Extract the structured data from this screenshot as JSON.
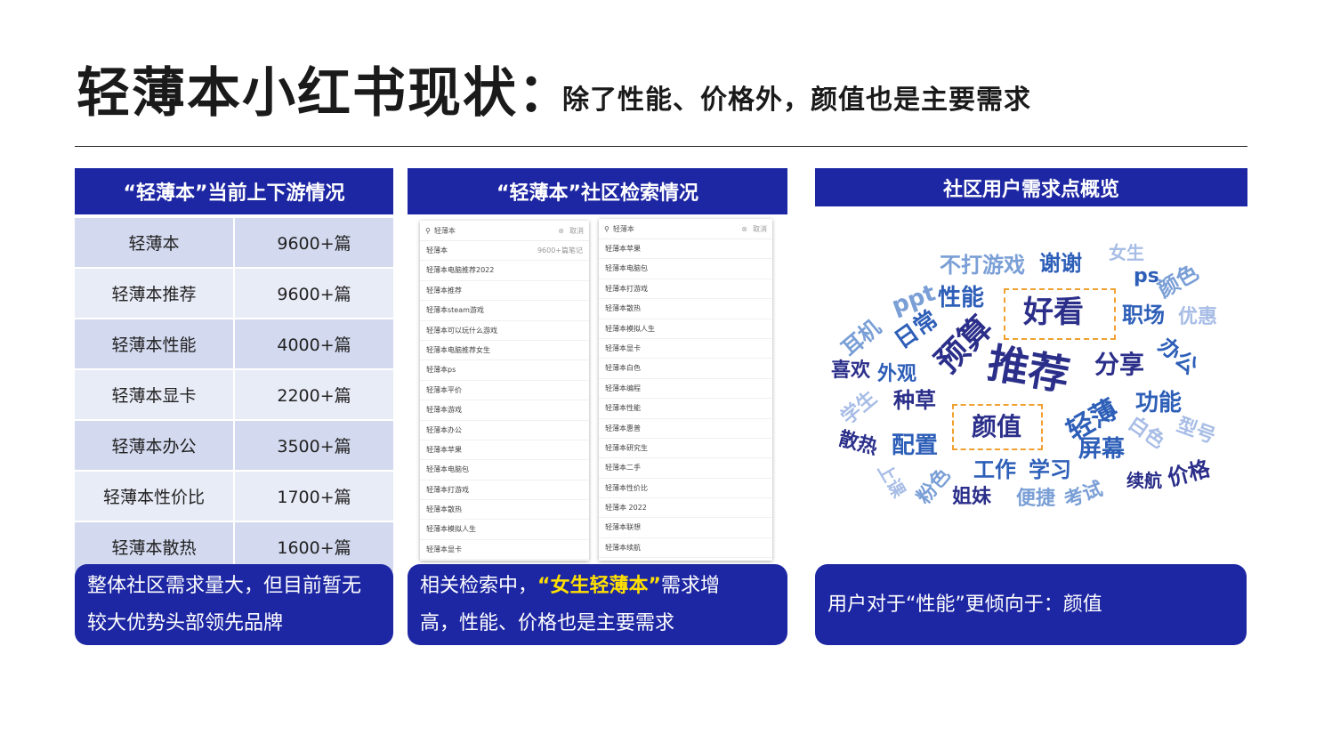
{
  "header": {
    "title": "轻薄本小红书现状：",
    "subtitle": "除了性能、价格外，颜值也是主要需求"
  },
  "panel1": {
    "title": "“轻薄本”当前上下游情况",
    "rows": [
      {
        "keyword": "轻薄本",
        "count": "9600+篇"
      },
      {
        "keyword": "轻薄本推荐",
        "count": "9600+篇"
      },
      {
        "keyword": "轻薄本性能",
        "count": "4000+篇"
      },
      {
        "keyword": "轻薄本显卡",
        "count": "2200+篇"
      },
      {
        "keyword": "轻薄本办公",
        "count": "3500+篇"
      },
      {
        "keyword": "轻薄本性价比",
        "count": "1700+篇"
      },
      {
        "keyword": "轻薄本散热",
        "count": "1600+篇"
      }
    ],
    "summary_line1": "整体社区需求量大，但目前暂无",
    "summary_line2": "较大优势头部领先品牌"
  },
  "panel2": {
    "title": "“轻薄本”社区检索情况",
    "search_left": {
      "query": "轻薄本",
      "cancel": "取消",
      "items": [
        {
          "text": "轻薄本",
          "count": "9600+篇笔记"
        },
        {
          "text": "轻薄本电脑推荐2022",
          "count": ""
        },
        {
          "text": "轻薄本推荐",
          "count": ""
        },
        {
          "text": "轻薄本steam游戏",
          "count": ""
        },
        {
          "text": "轻薄本可以玩什么游戏",
          "count": ""
        },
        {
          "text": "轻薄本电脑推荐女生",
          "count": ""
        },
        {
          "text": "轻薄本ps",
          "count": ""
        },
        {
          "text": "轻薄本平价",
          "count": ""
        },
        {
          "text": "轻薄本游戏",
          "count": ""
        },
        {
          "text": "轻薄本办公",
          "count": ""
        },
        {
          "text": "轻薄本苹果",
          "count": ""
        },
        {
          "text": "轻薄本电脑包",
          "count": ""
        },
        {
          "text": "轻薄本打游戏",
          "count": ""
        },
        {
          "text": "轻薄本散热",
          "count": ""
        },
        {
          "text": "轻薄本模拟人生",
          "count": ""
        },
        {
          "text": "轻薄本显卡",
          "count": ""
        }
      ]
    },
    "search_right": {
      "query": "轻薄本",
      "cancel": "取消",
      "items": [
        {
          "text": "轻薄本苹果",
          "count": ""
        },
        {
          "text": "轻薄本电脑包",
          "count": ""
        },
        {
          "text": "轻薄本打游戏",
          "count": ""
        },
        {
          "text": "轻薄本散热",
          "count": ""
        },
        {
          "text": "轻薄本模拟人生",
          "count": ""
        },
        {
          "text": "轻薄本显卡",
          "count": ""
        },
        {
          "text": "轻薄本白色",
          "count": ""
        },
        {
          "text": "轻薄本编程",
          "count": ""
        },
        {
          "text": "轻薄本性能",
          "count": ""
        },
        {
          "text": "轻薄本惠普",
          "count": ""
        },
        {
          "text": "轻薄本研究生",
          "count": ""
        },
        {
          "text": "轻薄本二手",
          "count": ""
        },
        {
          "text": "轻薄本性价比",
          "count": ""
        },
        {
          "text": "轻薄本 2022",
          "count": ""
        },
        {
          "text": "轻薄本联想",
          "count": ""
        },
        {
          "text": "轻薄本续航",
          "count": ""
        }
      ]
    },
    "summary_pre": "相关检索中，",
    "summary_highlight": "“女生轻薄本”",
    "summary_post": "需求增",
    "summary_line2": "高，性能、价格也是主要需求"
  },
  "panel3": {
    "title": "社区用户需求点概览",
    "summary": "用户对于“性能”更倾向于：颜值",
    "colors": {
      "dark": "#2b2f8a",
      "mid": "#2e5fb8",
      "light": "#7a9fd6",
      "pale": "#a8bde6",
      "box": "#f0a030"
    },
    "words": [
      {
        "text": "不打游戏",
        "tone": "light"
      },
      {
        "text": "谢谢",
        "tone": "mid"
      },
      {
        "text": "女生",
        "tone": "pale"
      },
      {
        "text": "ps",
        "tone": "mid"
      },
      {
        "text": "颜色",
        "tone": "light"
      },
      {
        "text": "ppt",
        "tone": "light"
      },
      {
        "text": "性能",
        "tone": "mid"
      },
      {
        "text": "好看",
        "tone": "dark"
      },
      {
        "text": "职场",
        "tone": "mid"
      },
      {
        "text": "优惠",
        "tone": "pale"
      },
      {
        "text": "耳机",
        "tone": "light"
      },
      {
        "text": "日常",
        "tone": "mid"
      },
      {
        "text": "预算",
        "tone": "dark"
      },
      {
        "text": "推荐",
        "tone": "dark"
      },
      {
        "text": "分享",
        "tone": "dark"
      },
      {
        "text": "办公",
        "tone": "mid"
      },
      {
        "text": "喜欢",
        "tone": "dark"
      },
      {
        "text": "外观",
        "tone": "mid"
      },
      {
        "text": "学生",
        "tone": "pale"
      },
      {
        "text": "种草",
        "tone": "dark"
      },
      {
        "text": "颜值",
        "tone": "dark"
      },
      {
        "text": "轻薄",
        "tone": "mid"
      },
      {
        "text": "功能",
        "tone": "mid"
      },
      {
        "text": "白色",
        "tone": "pale"
      },
      {
        "text": "型号",
        "tone": "pale"
      },
      {
        "text": "散热",
        "tone": "dark"
      },
      {
        "text": "配置",
        "tone": "mid"
      },
      {
        "text": "屏幕",
        "tone": "mid"
      },
      {
        "text": "工作",
        "tone": "mid"
      },
      {
        "text": "学习",
        "tone": "mid"
      },
      {
        "text": "上课",
        "tone": "pale"
      },
      {
        "text": "粉色",
        "tone": "light"
      },
      {
        "text": "姐妹",
        "tone": "dark"
      },
      {
        "text": "便捷",
        "tone": "light"
      },
      {
        "text": "考试",
        "tone": "light"
      },
      {
        "text": "续航",
        "tone": "dark"
      },
      {
        "text": "价格",
        "tone": "dark"
      }
    ]
  }
}
